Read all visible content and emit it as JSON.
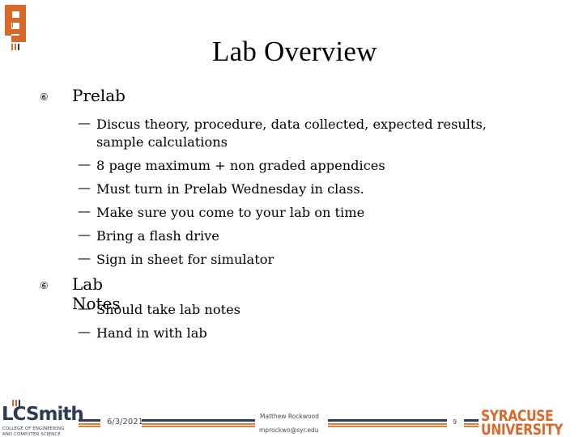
{
  "slide": {
    "title": "Lab Overview",
    "sections": [
      {
        "heading": "Prelab",
        "bullet_icon": "circled-six-icon",
        "items": [
          "Discus theory, procedure, data collected, expected results,",
          "sample calculations",
          "8 page maximum + non graded appendices",
          "Must turn in Prelab Wednesday in class.",
          "Make sure you come to your lab on time",
          "Bring a flash drive",
          "Sign in sheet for simulator"
        ]
      },
      {
        "heading": "Lab Notes",
        "bullet_icon": "circled-six-icon",
        "items": [
          "Should take lab notes",
          "Hand in with lab"
        ]
      }
    ],
    "bullet_glyph": "⑥",
    "dash_glyph": "—"
  },
  "footer": {
    "date": "6/3/2021",
    "author": "Matthew Rockwood",
    "email": "mprockwo@syr.edu",
    "page_number": "9",
    "left_logo": {
      "main": "LCSmith",
      "line1": "COLLEGE OF ENGINEERING",
      "line2": "AND COMPUTER SCIENCE"
    },
    "right_logo": {
      "line1": "SYRACUSE",
      "line2": "UNIVERSITY"
    }
  },
  "colors": {
    "orange": "#d9692a",
    "navy": "#2f3a55",
    "stripe_orange": "#d9823f"
  }
}
